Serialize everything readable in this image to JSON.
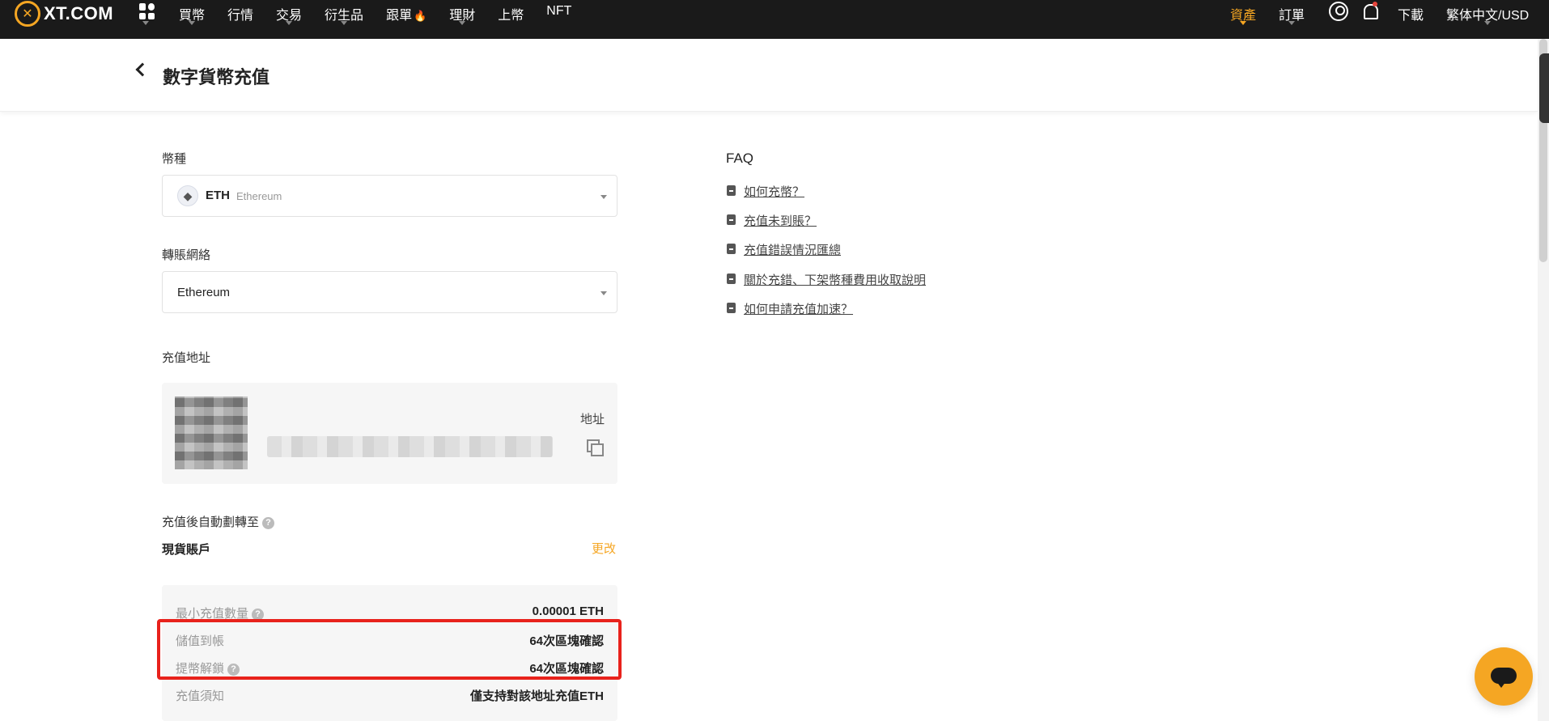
{
  "header": {
    "logo_text": "XT.COM",
    "nav": [
      {
        "label": "買幣"
      },
      {
        "label": "行情"
      },
      {
        "label": "交易"
      },
      {
        "label": "衍生品"
      },
      {
        "label": "跟單"
      },
      {
        "label": "理財"
      },
      {
        "label": "上幣"
      },
      {
        "label": "NFT"
      }
    ],
    "assets": "資產",
    "orders": "訂單",
    "download": "下載",
    "language": "繁体中文/USD"
  },
  "page": {
    "title": "數字貨幣充值"
  },
  "form": {
    "coin_label": "幣種",
    "coin_symbol": "ETH",
    "coin_name": "Ethereum",
    "network_label": "轉賬網絡",
    "network_value": "Ethereum",
    "address_label": "充值地址",
    "address_side_label": "地址",
    "transfer_label": "充值後自動劃轉至",
    "transfer_account": "現貨賬戶",
    "change": "更改"
  },
  "info": {
    "min_deposit_label": "最小充值數量",
    "min_deposit_value": "0.00001 ETH",
    "credit_label": "儲值到帳",
    "credit_value": "64次區塊確認",
    "unlock_label": "提幣解鎖",
    "unlock_value": "64次區塊確認",
    "notice_label": "充值須知",
    "notice_value": "僅支持對該地址充值ETH"
  },
  "faq": {
    "title": "FAQ",
    "items": [
      {
        "label": "如何充幣？"
      },
      {
        "label": "充值未到賬？"
      },
      {
        "label": "充值錯誤情況匯總"
      },
      {
        "label": "關於充錯、下架幣種費用收取說明"
      },
      {
        "label": "如何申請充值加速？"
      }
    ]
  },
  "colors": {
    "accent": "#f5a623",
    "highlight": "#e8221c",
    "topbar": "#1a1a1a"
  }
}
